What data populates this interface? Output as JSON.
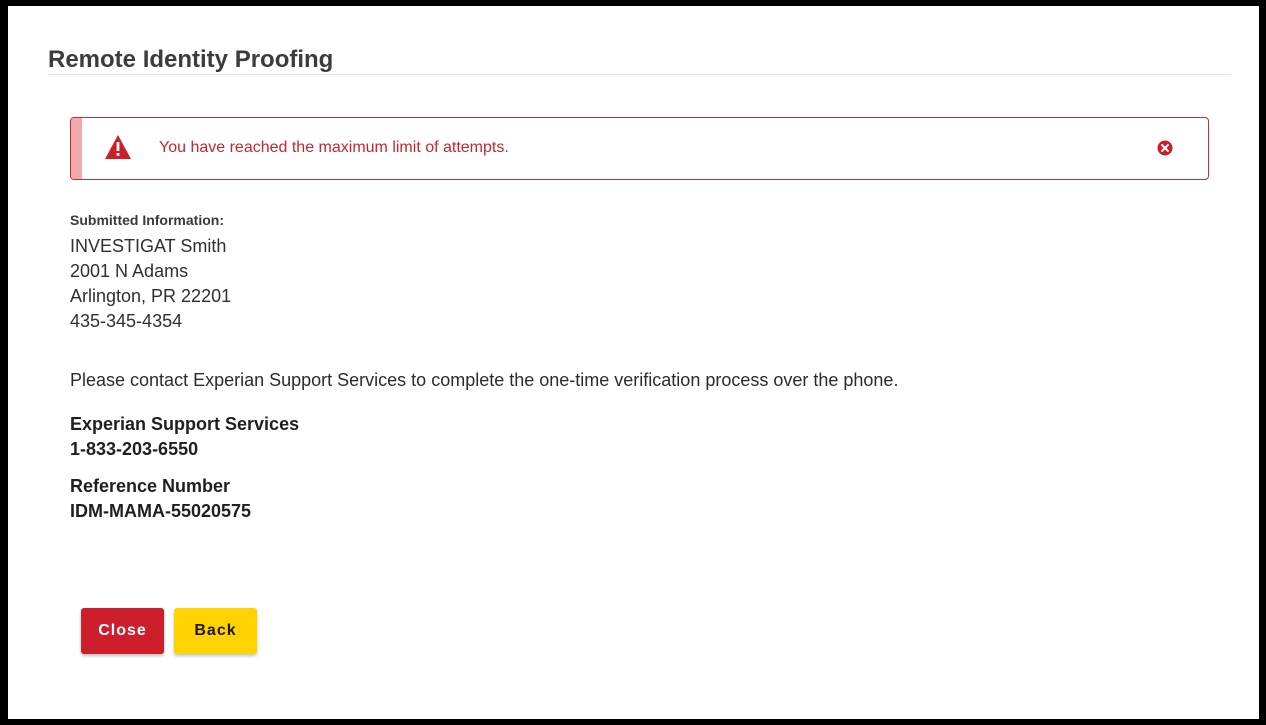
{
  "page": {
    "title": "Remote Identity Proofing"
  },
  "alert": {
    "message": "You have reached the maximum limit of attempts.",
    "icon": "warning-triangle-icon",
    "close_icon": "close-circle-icon",
    "color": "#c8262e"
  },
  "submitted": {
    "label": "Submitted Information:",
    "name": "INVESTIGAT Smith",
    "street": "2001 N Adams",
    "city_state_zip": "Arlington, PR 22201",
    "phone": "435-345-4354"
  },
  "instruction": "Please contact Experian Support Services to complete the one-time verification process over the phone.",
  "support": {
    "label": "Experian Support Services",
    "phone": "1-833-203-6550"
  },
  "reference": {
    "label": "Reference Number",
    "value": "IDM-MAMA-55020575"
  },
  "buttons": {
    "close_label": "Close",
    "back_label": "Back"
  },
  "colors": {
    "close_button": "#cc1f2b",
    "back_button": "#ffd200"
  }
}
